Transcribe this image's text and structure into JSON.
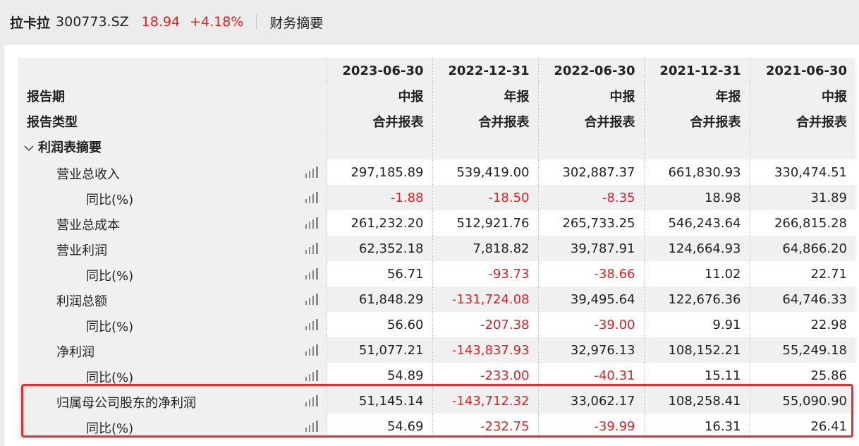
{
  "header": {
    "name": "拉卡拉",
    "code": "300773.SZ",
    "price": "18.94",
    "change": "+4.18%",
    "tab": "财务摘要"
  },
  "table": {
    "header_rows": [
      {
        "label": "",
        "values": [
          "2023-06-30",
          "2022-12-31",
          "2022-06-30",
          "2021-12-31",
          "2021-06-30"
        ]
      },
      {
        "label": "报告期",
        "values": [
          "中报",
          "年报",
          "中报",
          "年报",
          "中报"
        ]
      },
      {
        "label": "报告类型",
        "values": [
          "合并报表",
          "合并报表",
          "合并报表",
          "合并报表",
          "合并报表"
        ]
      }
    ],
    "section": "利润表摘要",
    "rows": [
      {
        "label": "营业总收入",
        "level": 1,
        "values": [
          "297,185.89",
          "539,419.00",
          "302,887.37",
          "661,830.93",
          "330,474.51"
        ]
      },
      {
        "label": "同比(%)",
        "level": 2,
        "values": [
          "-1.88",
          "-18.50",
          "-8.35",
          "18.98",
          "31.89"
        ]
      },
      {
        "label": "营业总成本",
        "level": 1,
        "values": [
          "261,232.20",
          "512,921.76",
          "265,733.25",
          "546,243.64",
          "266,815.28"
        ]
      },
      {
        "label": "营业利润",
        "level": 1,
        "values": [
          "62,352.18",
          "7,818.82",
          "39,787.91",
          "124,664.93",
          "64,866.20"
        ]
      },
      {
        "label": "同比(%)",
        "level": 2,
        "values": [
          "56.71",
          "-93.73",
          "-38.66",
          "11.02",
          "22.71"
        ]
      },
      {
        "label": "利润总额",
        "level": 1,
        "values": [
          "61,848.29",
          "-131,724.08",
          "39,495.64",
          "122,676.36",
          "64,746.33"
        ]
      },
      {
        "label": "同比(%)",
        "level": 2,
        "values": [
          "56.60",
          "-207.38",
          "-39.00",
          "9.91",
          "22.98"
        ]
      },
      {
        "label": "净利润",
        "level": 1,
        "values": [
          "51,077.21",
          "-143,837.93",
          "32,976.13",
          "108,152.21",
          "55,249.18"
        ]
      },
      {
        "label": "同比(%)",
        "level": 2,
        "values": [
          "54.89",
          "-233.00",
          "-40.31",
          "15.11",
          "25.86"
        ]
      },
      {
        "label": "归属母公司股东的净利润",
        "level": 1,
        "values": [
          "51,145.14",
          "-143,712.32",
          "33,062.17",
          "108,258.41",
          "55,090.90"
        ]
      },
      {
        "label": "同比(%)",
        "level": 2,
        "values": [
          "54.69",
          "-232.75",
          "-39.99",
          "16.31",
          "26.41"
        ]
      }
    ]
  },
  "colors": {
    "negative": "#e02020",
    "highlight_border": "#f02a2a",
    "row_shade": "#f0f0f0"
  }
}
